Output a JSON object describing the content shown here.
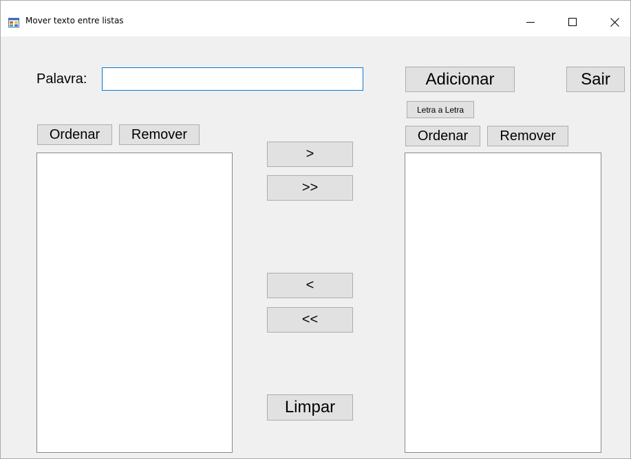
{
  "window": {
    "title": "Mover texto entre listas",
    "controls": {
      "minimize": "minimize-icon",
      "maximize": "maximize-icon",
      "close": "close-icon"
    }
  },
  "form": {
    "word_label": "Palavra:",
    "word_value": "",
    "add_button": "Adicionar",
    "exit_button": "Sair",
    "letter_button": "Letra a Letra"
  },
  "left_list": {
    "sort_button": "Ordenar",
    "remove_button": "Remover",
    "items": []
  },
  "right_list": {
    "sort_button": "Ordenar",
    "remove_button": "Remover",
    "items": []
  },
  "transfer": {
    "move_right": ">",
    "move_all_right": ">>",
    "move_left": "<",
    "move_all_left": "<<",
    "clear": "Limpar"
  },
  "colors": {
    "input_border": "#0078d7",
    "button_face": "#e1e1e1",
    "window_background": "#f0f0f0"
  }
}
